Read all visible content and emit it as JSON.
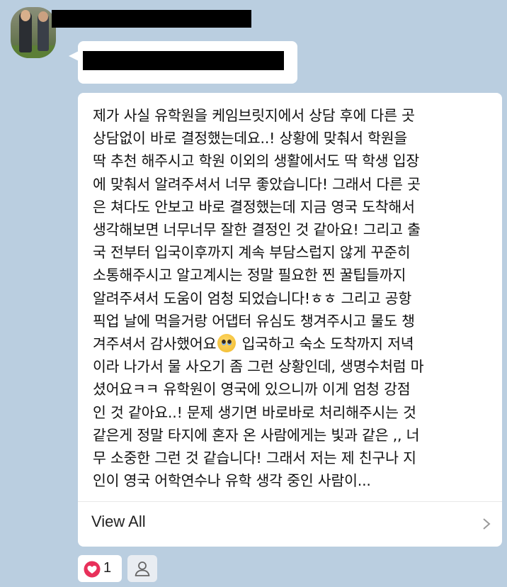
{
  "sender": {
    "avatar_alt": "profile photo",
    "name_redacted": true
  },
  "short_message": {
    "redacted": true
  },
  "post": {
    "text": "제가 사실 유학원을 케임브릿지에서 상담 후에 다른 곳\n상담없이 바로 결정했는데요..! 상황에 맞춰서 학원을\n딱 추천 해주시고 학원 이외의 생활에서도 딱 학생 입장\n에 맞춰서 알려주셔서 너무 좋았습니다! 그래서 다른 곳\n은 쳐다도 안보고 바로 결정했는데 지금 영국 도착해서\n생각해보면 너무너무 잘한 결정인 것 같아요! 그리고 출\n국 전부터 입국이후까지 계속 부담스럽지 않게 꾸준히\n소통해주시고 알고계시는 정말 필요한 찐 꿀팁들까지\n알려주셔서 도움이 엄청 되었습니다!ㅎㅎ 그리고 공항\n픽업 날에 먹을거랑 어댑터 유심도 챙겨주시고 물도 챙\n겨주셔서 감사했어요",
    "text_after_emoji": "  입국하고 숙소 도착까지 저녁\n이라 나가서 물 사오기 좀 그런 상황인데, 생명수처럼 마\n셨어요ㅋㅋ 유학원이 영국에 있으니까 이게 엄청 강점\n인 것 같아요..! 문제 생기면 바로바로 처리해주시는 것\n같은게 정말 타지에 혼자 온 사람에게는 빛과 같은 ,, 너\n무 소중한 그런 것 같습니다! 그래서 저는 제 친구나 지\n인이 영국 어학연수나 유학 생각 중인 사람이...",
    "emoji": "pleading-face-icon",
    "view_all_label": "View All"
  },
  "reactions": {
    "like_count": "1",
    "heart_color": "#e8305a"
  },
  "colors": {
    "background": "#bacee0",
    "bubble": "#ffffff"
  }
}
